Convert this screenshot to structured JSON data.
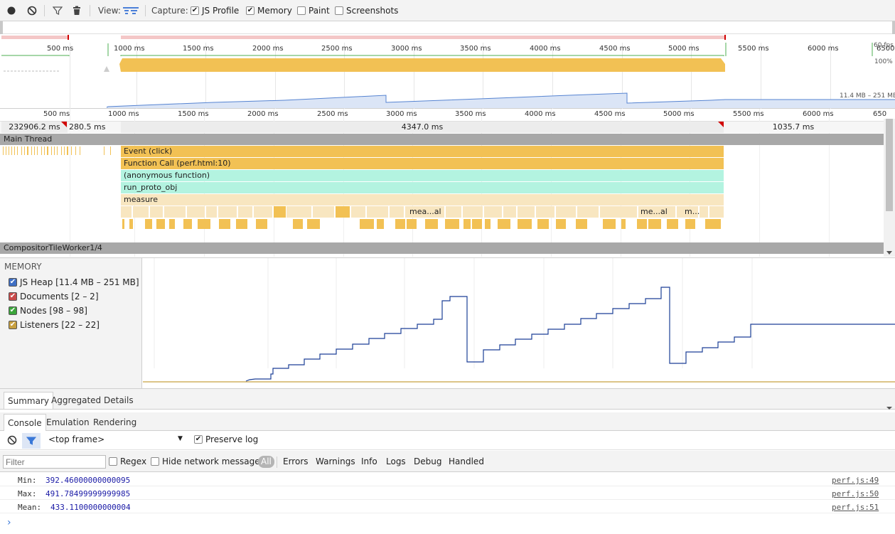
{
  "toolbar": {
    "view_label": "View:",
    "capture_label": "Capture:",
    "js_profile_label": "JS Profile",
    "memory_label": "Memory",
    "paint_label": "Paint",
    "screenshots_label": "Screenshots",
    "js_profile_checked": true,
    "memory_checked": true,
    "paint_checked": false,
    "screenshots_checked": false
  },
  "overview": {
    "ticks": [
      "500 ms",
      "1000 ms",
      "1500 ms",
      "2000 ms",
      "2500 ms",
      "3000 ms",
      "3500 ms",
      "4000 ms",
      "4500 ms",
      "5000 ms",
      "5500 ms",
      "6000 ms",
      "6500"
    ],
    "fps_label": "60 fps",
    "cpu_label": "100%",
    "memory_range_label": "11.4 MB – 251 MB"
  },
  "timeline": {
    "ticks": [
      "500 ms",
      "1000 ms",
      "1500 ms",
      "2000 ms",
      "2500 ms",
      "3000 ms",
      "3500 ms",
      "4000 ms",
      "4500 ms",
      "5000 ms",
      "5500 ms",
      "6000 ms",
      "650"
    ],
    "frames": [
      "232906.2 ms",
      "280.5 ms",
      "4347.0 ms",
      "1035.7 ms"
    ],
    "main_thread_label": "Main Thread",
    "events": {
      "event_click": "Event (click)",
      "function_call": "Function Call (perf.html:10)",
      "anonymous": "(anonymous function)",
      "run_proto": "run_proto_obj",
      "measure": "measure",
      "small_1": "mea...al",
      "small_2": "me...al",
      "small_3": "m..."
    },
    "compositor_label": "CompositorTileWorker1/4"
  },
  "memory": {
    "title": "MEMORY",
    "counters": [
      {
        "label": "JS Heap [11.4 MB – 251 MB]",
        "color": "#3f6fc4",
        "checked": true
      },
      {
        "label": "Documents [2 – 2]",
        "color": "#c94a4a",
        "checked": true
      },
      {
        "label": "Nodes [98 – 98]",
        "color": "#3ba53b",
        "checked": true
      },
      {
        "label": "Listeners [22 – 22]",
        "color": "#c8a040",
        "checked": true
      }
    ]
  },
  "details_tabs": [
    "Summary",
    "Aggregated Details"
  ],
  "drawer": {
    "tabs": [
      "Console",
      "Emulation",
      "Rendering"
    ],
    "frame_select": "<top frame>",
    "preserve_log_label": "Preserve log",
    "preserve_log_checked": true,
    "filter_placeholder": "Filter",
    "regex_label": "Regex",
    "hide_network_label": "Hide network messages",
    "levels": [
      "All",
      "Errors",
      "Warnings",
      "Info",
      "Logs",
      "Debug",
      "Handled"
    ],
    "messages": [
      {
        "key": "Min:",
        "value": "392.46000000000095",
        "source": "perf.js:49"
      },
      {
        "key": "Max:",
        "value": "491.78499999999985",
        "source": "perf.js:50"
      },
      {
        "key": "Mean:",
        "value": "433.1100000000004",
        "source": "perf.js:51"
      }
    ],
    "prompt": "›"
  },
  "colors": {
    "scripting": "#f2c154",
    "scripting_light": "#f8e6c0",
    "anon": "#b3f3e0",
    "heap_line": "#1c3f96"
  }
}
